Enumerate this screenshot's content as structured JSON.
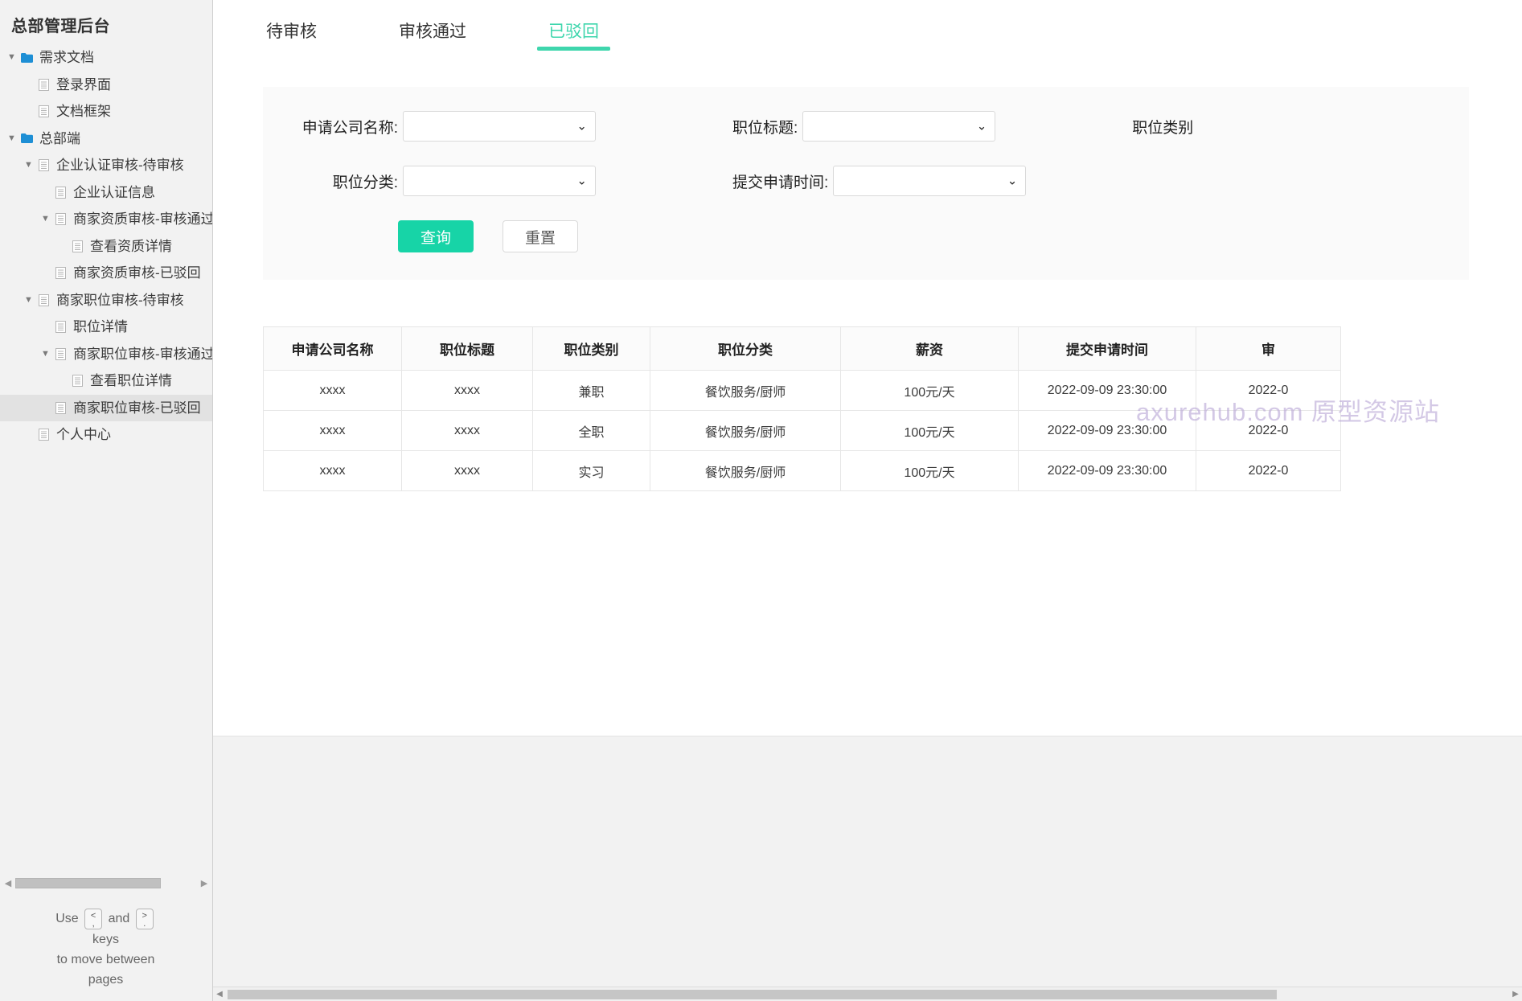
{
  "sidebar": {
    "title": "总部管理后台",
    "tree": [
      {
        "label": "需求文档",
        "icon": "folder-icon",
        "twisty": "down",
        "depth": 0,
        "selected": false
      },
      {
        "label": "登录界面",
        "icon": "page-icon",
        "twisty": "none",
        "depth": 1,
        "selected": false
      },
      {
        "label": "文档框架",
        "icon": "page-icon",
        "twisty": "none",
        "depth": 1,
        "selected": false
      },
      {
        "label": "总部端",
        "icon": "folder-icon",
        "twisty": "down",
        "depth": 0,
        "selected": false
      },
      {
        "label": "企业认证审核-待审核",
        "icon": "page-icon",
        "twisty": "down",
        "depth": 1,
        "selected": false
      },
      {
        "label": "企业认证信息",
        "icon": "page-icon",
        "twisty": "none",
        "depth": 2,
        "selected": false
      },
      {
        "label": "商家资质审核-审核通过",
        "icon": "page-icon",
        "twisty": "down",
        "depth": 2,
        "selected": false
      },
      {
        "label": "查看资质详情",
        "icon": "page-icon",
        "twisty": "none",
        "depth": 3,
        "selected": false
      },
      {
        "label": "商家资质审核-已驳回",
        "icon": "page-icon",
        "twisty": "none",
        "depth": 2,
        "selected": false
      },
      {
        "label": "商家职位审核-待审核",
        "icon": "page-icon",
        "twisty": "down",
        "depth": 1,
        "selected": false
      },
      {
        "label": "职位详情",
        "icon": "page-icon",
        "twisty": "none",
        "depth": 2,
        "selected": false
      },
      {
        "label": "商家职位审核-审核通过",
        "icon": "page-icon",
        "twisty": "down",
        "depth": 2,
        "selected": false
      },
      {
        "label": "查看职位详情",
        "icon": "page-icon",
        "twisty": "none",
        "depth": 3,
        "selected": false
      },
      {
        "label": "商家职位审核-已驳回",
        "icon": "page-icon",
        "twisty": "none",
        "depth": 2,
        "selected": true
      },
      {
        "label": "个人中心",
        "icon": "page-icon",
        "twisty": "none",
        "depth": 1,
        "selected": false
      }
    ],
    "help": {
      "use": "Use",
      "key_prev_top": "<",
      "key_prev_bottom": ",",
      "and": "and",
      "key_next_top": ">",
      "key_next_bottom": ".",
      "line2": "keys",
      "line3": "to move between",
      "line4": "pages"
    }
  },
  "tabs": [
    {
      "label": "待审核",
      "active": false
    },
    {
      "label": "审核通过",
      "active": false
    },
    {
      "label": "已驳回",
      "active": true
    }
  ],
  "filters": {
    "fields": [
      {
        "label": "申请公司名称:",
        "value": ""
      },
      {
        "label": "职位标题:",
        "value": ""
      },
      {
        "label": "职位类别",
        "value": ""
      },
      {
        "label": "职位分类:",
        "value": ""
      },
      {
        "label": "提交申请时间:",
        "value": ""
      }
    ],
    "search_button": "查询",
    "reset_button": "重置"
  },
  "table": {
    "columns": [
      "申请公司名称",
      "职位标题",
      "职位类别",
      "职位分类",
      "薪资",
      "提交申请时间",
      "审"
    ],
    "rows": [
      [
        "xxxx",
        "xxxx",
        "兼职",
        "餐饮服务/厨师",
        "100元/天",
        "2022-09-09 23:30:00",
        "2022-0"
      ],
      [
        "xxxx",
        "xxxx",
        "全职",
        "餐饮服务/厨师",
        "100元/天",
        "2022-09-09 23:30:00",
        "2022-0"
      ],
      [
        "xxxx",
        "xxxx",
        "实习",
        "餐饮服务/厨师",
        "100元/天",
        "2022-09-09 23:30:00",
        "2022-0"
      ]
    ]
  },
  "watermark": "axurehub.com 原型资源站",
  "colors": {
    "accent": "#17d4a7",
    "tab_active": "#3fd6ad",
    "sidebar_bg": "#f2f2f2",
    "panel_bg": "#fafafa",
    "watermark": "#b9a7d6"
  }
}
